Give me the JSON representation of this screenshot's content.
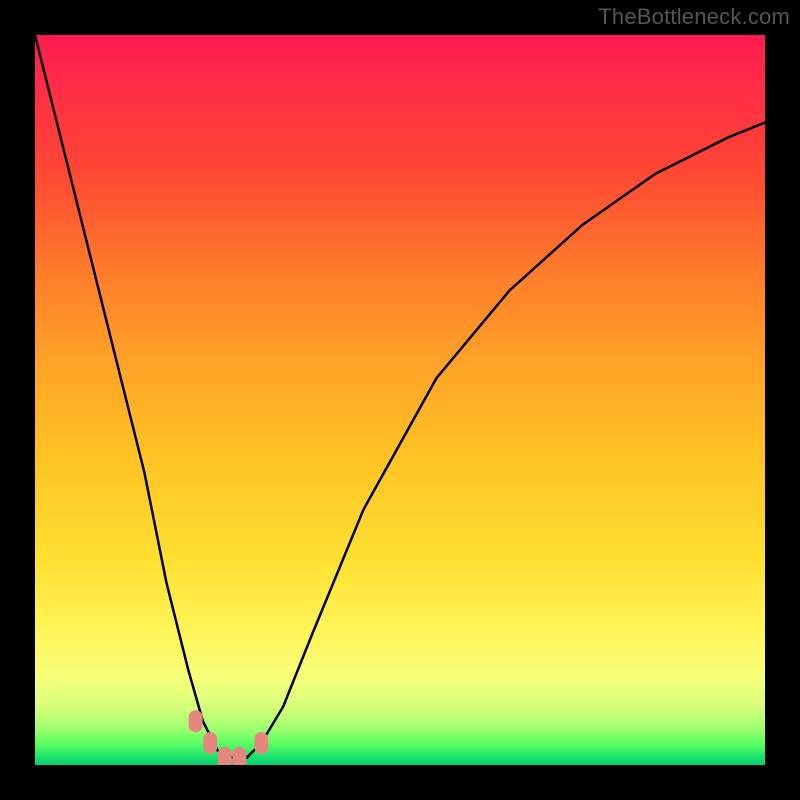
{
  "watermark": "TheBottleneck.com",
  "chart_data": {
    "type": "line",
    "title": "",
    "xlabel": "",
    "ylabel": "",
    "x_range": [
      0,
      100
    ],
    "y_range": [
      0,
      100
    ],
    "curve": {
      "x": [
        0,
        5,
        10,
        15,
        18,
        21,
        23,
        25,
        27,
        29,
        31,
        34,
        38,
        45,
        55,
        65,
        75,
        85,
        95,
        100
      ],
      "y": [
        100,
        80,
        60,
        40,
        25,
        13,
        6,
        2,
        1,
        1,
        3,
        8,
        18,
        35,
        53,
        65,
        74,
        81,
        86,
        88
      ]
    },
    "markers": [
      {
        "x": 22,
        "y": 6
      },
      {
        "x": 24,
        "y": 3
      },
      {
        "x": 26,
        "y": 1
      },
      {
        "x": 28,
        "y": 1
      },
      {
        "x": 31,
        "y": 3
      }
    ],
    "note": "V-shaped bottleneck curve over rainbow heatmap background. Y encodes bottleneck severity (top=high/red, bottom=low/green). Minimum near x≈27."
  }
}
